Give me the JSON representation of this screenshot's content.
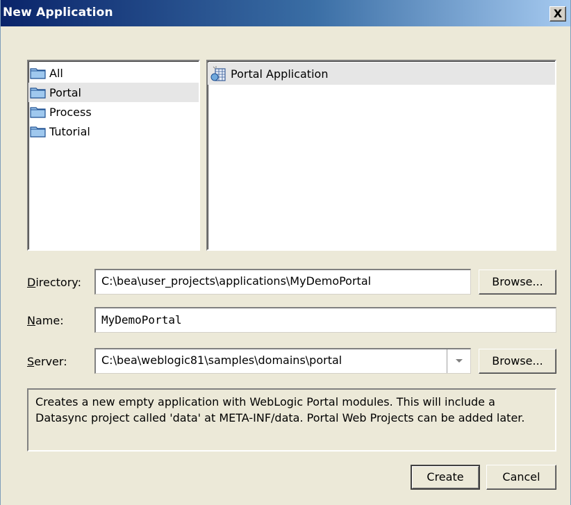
{
  "window": {
    "title": "New Application",
    "close_label": "X"
  },
  "categories": [
    {
      "label": "All",
      "icon": "folder-icon"
    },
    {
      "label": "Portal",
      "icon": "folder-icon",
      "selected": true
    },
    {
      "label": "Process",
      "icon": "folder-icon"
    },
    {
      "label": "Tutorial",
      "icon": "folder-icon"
    }
  ],
  "templates": [
    {
      "label": "Portal Application",
      "icon": "portal-application-icon",
      "selected": true
    }
  ],
  "form": {
    "directory": {
      "label_underline": "D",
      "label_rest": "irectory:",
      "value": "C:\\bea\\user_projects\\applications\\MyDemoPortal",
      "browse_label": "Browse..."
    },
    "name": {
      "label_underline": "N",
      "label_rest": "ame:",
      "value": "MyDemoPortal"
    },
    "server": {
      "label_underline": "S",
      "label_rest": "erver:",
      "value": "C:\\bea\\weblogic81\\samples\\domains\\portal",
      "browse_label": "Browse..."
    }
  },
  "description": "Creates a new empty application with WebLogic Portal modules. This will include a Datasync project called 'data' at META-INF/data. Portal Web Projects can be added later.",
  "buttons": {
    "create": "Create",
    "cancel": "Cancel"
  },
  "colors": {
    "titlebar_start": "#0a246a",
    "titlebar_end": "#a6caf0",
    "dialog_bg": "#ece9d8",
    "selection_bg": "#e6e6e6"
  }
}
